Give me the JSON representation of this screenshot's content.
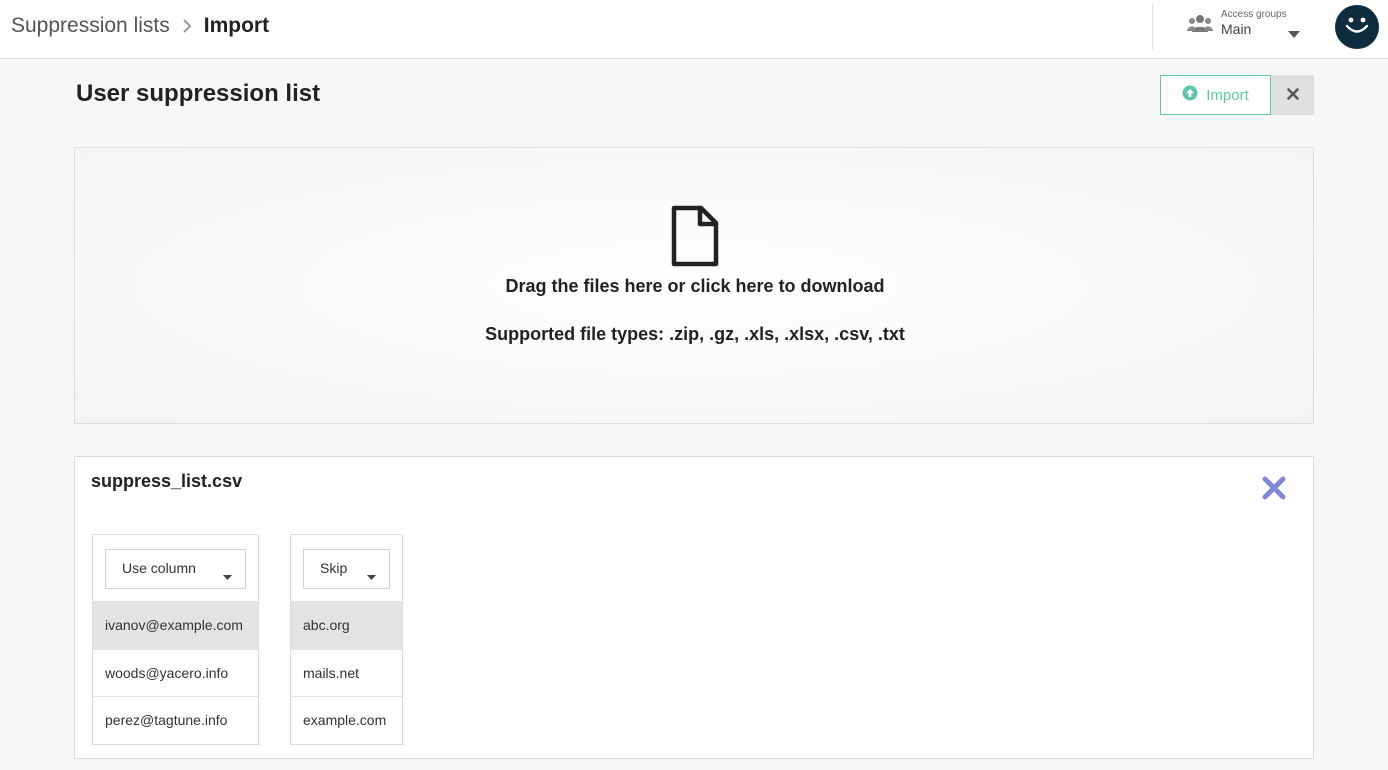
{
  "header": {
    "breadcrumb_parent": "Suppression lists",
    "breadcrumb_current": "Import",
    "access_groups_label": "Access groups",
    "access_groups_value": "Main",
    "icons": {
      "separator": "chevron-right-icon",
      "users": "users-icon",
      "caret": "caret-down-icon",
      "avatar": "smiley-face-icon"
    }
  },
  "page": {
    "title": "User suppression list",
    "import_label": "Import",
    "icons": {
      "import": "upload-circle-icon",
      "close": "close-icon"
    }
  },
  "dropzone": {
    "line1": "Drag the files here or click here to download",
    "line2": "Supported file types: .zip, .gz, .xls, .xlsx, .csv, .txt",
    "icon": "file-icon"
  },
  "file": {
    "name": "suppress_list.csv",
    "remove_icon": "close-x-icon",
    "columns": [
      {
        "selected": "Use column",
        "rows": [
          "ivanov@example.com",
          "woods@yacero.info",
          "perez@tagtune.info"
        ]
      },
      {
        "selected": "Skip",
        "rows": [
          "abc.org",
          "mails.net",
          "example.com"
        ]
      }
    ]
  },
  "colors": {
    "accent": "#5cc8a7",
    "avatar_bg": "#0f2b3e",
    "remove_x": "#7f87d6",
    "highlight_row": "#e3e3e3"
  }
}
